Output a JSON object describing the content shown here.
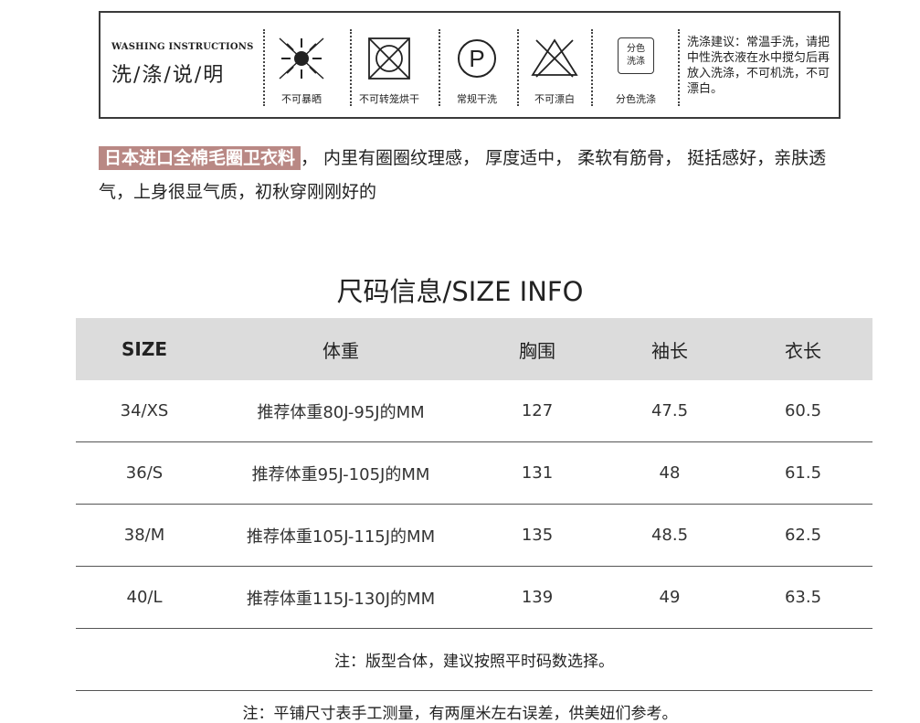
{
  "wash": {
    "title_en": "WASHING INSTRUCTIONS",
    "title_cn": "洗/涤/说/明",
    "symbols": [
      {
        "icon": "sun-crossed-icon",
        "label": "不可暴晒"
      },
      {
        "icon": "tumble-dry-crossed-icon",
        "label": "不可转笼烘干"
      },
      {
        "icon": "dry-clean-p-icon",
        "label": "常规干洗"
      },
      {
        "icon": "bleach-crossed-icon",
        "label": "不可漂白"
      },
      {
        "icon": "separate-wash-icon",
        "label": "分色洗涤",
        "box_text": "分色\n洗涤"
      }
    ],
    "advice": "洗涤建议：常温手洗，请把中性洗衣液在水中搅匀后再放入洗涤，不可机洗，不可漂白。"
  },
  "description": {
    "highlight": "日本进口全棉毛圈卫衣料",
    "text": "，  内里有圈圈纹理感，  厚度适中，  柔软有筋骨，  挺括感好，亲肤透气，上身很显气质，初秋穿刚刚好的"
  },
  "size_info": {
    "heading": "尺码信息/SIZE INFO",
    "headers": [
      "SIZE",
      "体重",
      "胸围",
      "袖长",
      "衣长"
    ],
    "rows": [
      [
        "34/XS",
        "推荐体重80J-95J的MM",
        "127",
        "47.5",
        "60.5"
      ],
      [
        "36/S",
        "推荐体重95J-105J的MM",
        "131",
        "48",
        "61.5"
      ],
      [
        "38/M",
        "推荐体重105J-115J的MM",
        "135",
        "48.5",
        "62.5"
      ],
      [
        "40/L",
        "推荐体重115J-130J的MM",
        "139",
        "49",
        "63.5"
      ]
    ],
    "note1": "注：版型合体，建议按照平时码数选择。",
    "note2": "注：平铺尺寸表手工测量，有两厘米左右误差，供美妞们参考。"
  }
}
